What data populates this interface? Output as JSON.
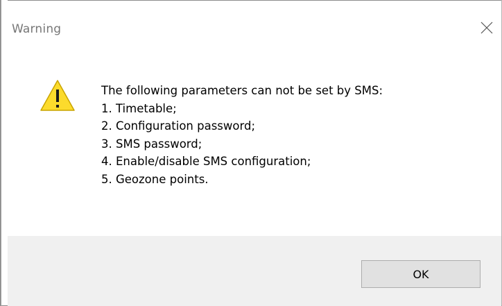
{
  "dialog": {
    "title": "Warning",
    "close_icon": "close-icon",
    "icon": "warning-icon",
    "message": {
      "heading": "The following parameters can not be set by SMS:",
      "items": [
        "1. Timetable;",
        "2. Configuration password;",
        "3. SMS password;",
        "4. Enable/disable SMS configuration;",
        "5. Geozone points."
      ]
    },
    "ok_label": "OK"
  },
  "colors": {
    "warning_fill": "#fcdb2c",
    "warning_stroke": "#c9a400",
    "footer_bg": "#f0f0f0",
    "button_bg": "#e1e1e1"
  }
}
